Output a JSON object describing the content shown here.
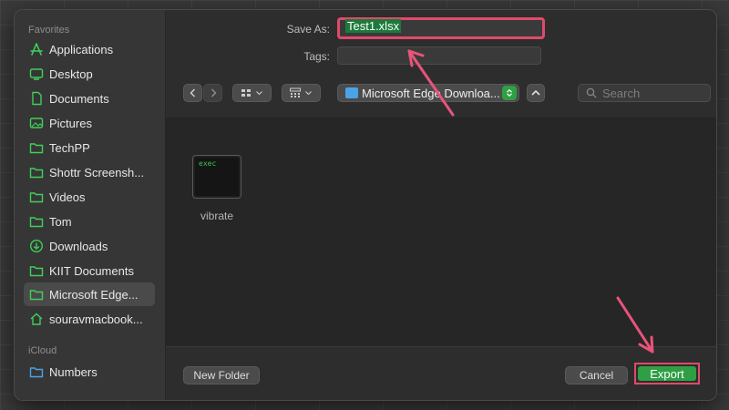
{
  "sidebar": {
    "favorites_title": "Favorites",
    "icloud_title": "iCloud",
    "items": [
      {
        "label": "Applications",
        "icon": "applications-icon"
      },
      {
        "label": "Desktop",
        "icon": "desktop-icon"
      },
      {
        "label": "Documents",
        "icon": "document-icon"
      },
      {
        "label": "Pictures",
        "icon": "pictures-icon"
      },
      {
        "label": "TechPP",
        "icon": "folder-icon"
      },
      {
        "label": "Shottr Screensh...",
        "icon": "folder-icon"
      },
      {
        "label": "Videos",
        "icon": "folder-icon"
      },
      {
        "label": "Tom",
        "icon": "folder-icon"
      },
      {
        "label": "Downloads",
        "icon": "downloads-icon"
      },
      {
        "label": "KIIT Documents",
        "icon": "folder-icon"
      },
      {
        "label": "Microsoft Edge...",
        "icon": "folder-icon",
        "selected": true
      },
      {
        "label": "souravmacbook...",
        "icon": "home-icon"
      }
    ],
    "icloud_items": [
      {
        "label": "Numbers",
        "icon": "folder-icon"
      }
    ]
  },
  "form": {
    "save_as_label": "Save As:",
    "save_as_value": "Test1.xlsx",
    "tags_label": "Tags:",
    "tags_value": ""
  },
  "toolbar": {
    "location": "Microsoft Edge Downloa...",
    "search_placeholder": "Search"
  },
  "files": [
    {
      "name": "vibrate",
      "thumb_text": "exec"
    }
  ],
  "buttons": {
    "new_folder": "New Folder",
    "cancel": "Cancel",
    "export": "Export"
  },
  "colors": {
    "accent_green": "#2ea043",
    "annotation": "#e04a6a",
    "sidebar_icon": "#3fcf5a"
  }
}
